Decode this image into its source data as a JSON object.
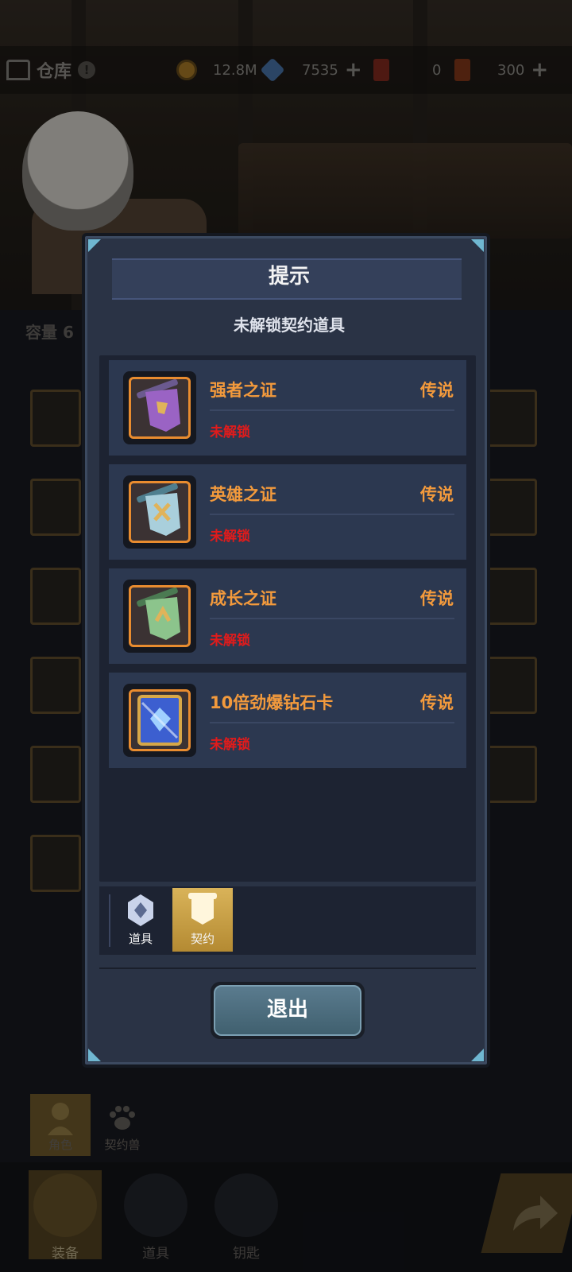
{
  "topbar": {
    "warehouse_title": "仓库",
    "warehouse_badge": "!",
    "gold": "12.8M",
    "gems": "7535",
    "tickets_red": "0",
    "tickets_gold": "300",
    "plus": "+"
  },
  "background": {
    "capacity_label": "容量 6"
  },
  "dialog": {
    "title": "提示",
    "subtitle": "未解锁契约道具",
    "items": [
      {
        "name": "强者之证",
        "rarity": "传说",
        "status": "未解锁",
        "icon": "purple-banner-icon"
      },
      {
        "name": "英雄之证",
        "rarity": "传说",
        "status": "未解锁",
        "icon": "lightblue-banner-icon"
      },
      {
        "name": "成长之证",
        "rarity": "传说",
        "status": "未解锁",
        "icon": "green-banner-icon"
      },
      {
        "name": "10倍劲爆钻石卡",
        "rarity": "传说",
        "status": "未解锁",
        "icon": "diamond-card-icon"
      }
    ],
    "tabs": [
      {
        "label": "道具",
        "active": false
      },
      {
        "label": "契约",
        "active": true
      }
    ],
    "exit_label": "退出"
  },
  "sub_tabs": [
    {
      "label": "角色"
    },
    {
      "label": "契约兽"
    }
  ],
  "bottom_nav": [
    {
      "label": "装备"
    },
    {
      "label": "道具"
    },
    {
      "label": "钥匙"
    }
  ],
  "colors": {
    "rarity_orange": "#f39a3c",
    "locked_red": "#e11b1b",
    "dialog_bg": "#2a3345",
    "active_tab_gold": "#d9b359"
  }
}
